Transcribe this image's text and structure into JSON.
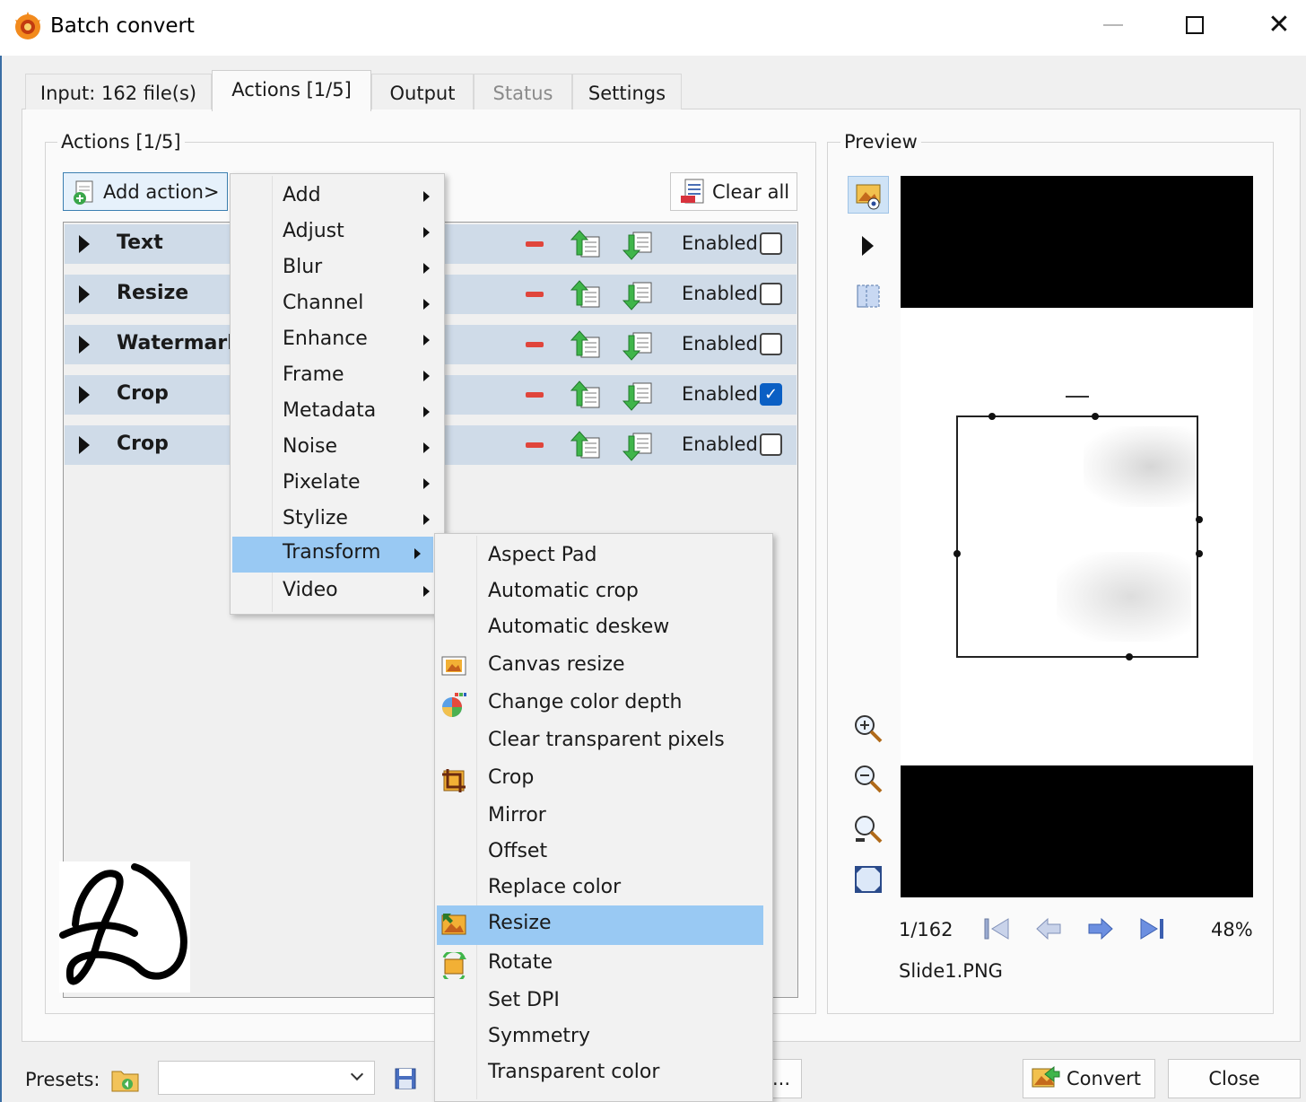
{
  "window": {
    "title": "Batch convert",
    "minimize_icon": "minimize-icon",
    "maximize_icon": "maximize-icon",
    "close_glyph": "✕"
  },
  "tabs": [
    {
      "label": "Input: 162 file(s)"
    },
    {
      "label": "Actions [1/5]"
    },
    {
      "label": "Output"
    },
    {
      "label": "Status"
    },
    {
      "label": "Settings"
    }
  ],
  "actions_group": {
    "label": "Actions [1/5]",
    "add_action_label": "Add action>",
    "clear_all_label": "Clear all",
    "items": [
      {
        "name": "Text",
        "enabled_label": "Enabled",
        "enabled": false
      },
      {
        "name": "Resize",
        "enabled_label": "Enabled",
        "enabled": false
      },
      {
        "name": "Watermark",
        "enabled_label": "Enabled",
        "enabled": false
      },
      {
        "name": "Crop",
        "enabled_label": "Enabled",
        "enabled": true
      },
      {
        "name": "Crop",
        "enabled_label": "Enabled",
        "enabled": false
      }
    ]
  },
  "add_menu": {
    "items": [
      "Add",
      "Adjust",
      "Blur",
      "Channel",
      "Enhance",
      "Frame",
      "Metadata",
      "Noise",
      "Pixelate",
      "Stylize",
      "Transform",
      "Video"
    ],
    "highlighted": "Transform"
  },
  "transform_submenu": {
    "items": [
      "Aspect Pad",
      "Automatic crop",
      "Automatic deskew",
      "Canvas resize",
      "Change color depth",
      "Clear transparent pixels",
      "Crop",
      "Mirror",
      "Offset",
      "Replace color",
      "Resize",
      "Rotate",
      "Set DPI",
      "Symmetry",
      "Transparent color"
    ],
    "highlighted": "Resize"
  },
  "preview": {
    "label": "Preview",
    "page_indicator": "1/162",
    "zoom": "48%",
    "filename": "Slide1.PNG"
  },
  "bottom": {
    "presets_label": "Presets:",
    "presets_value": "",
    "ellipsis_label": "...",
    "convert_label": "Convert",
    "close_label": "Close"
  },
  "colors": {
    "row_bg": "#cfdbe8",
    "menu_highlight": "#99c9f3",
    "checkbox_on": "#0a5fc4",
    "window_bg": "#f0f0f0"
  }
}
